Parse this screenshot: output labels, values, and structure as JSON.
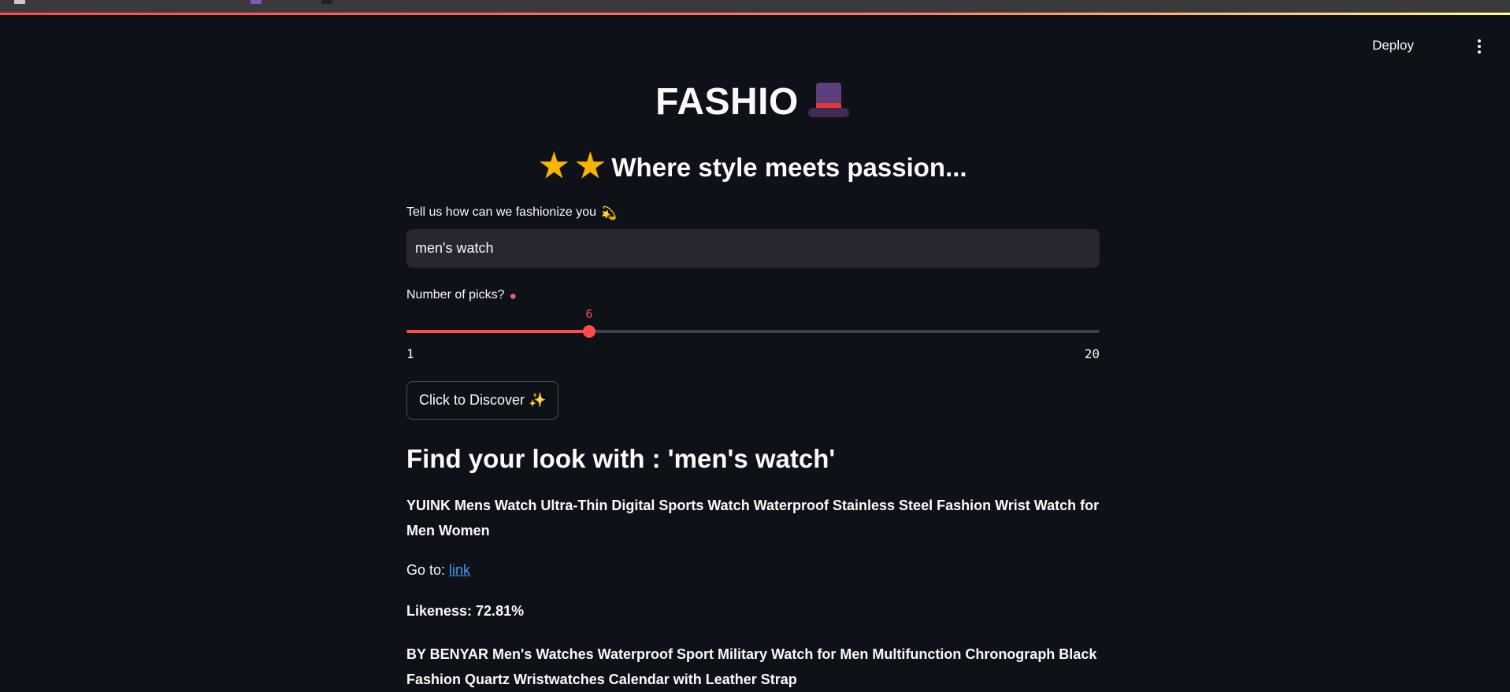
{
  "header": {
    "deploy_label": "Deploy",
    "menu_icon": "kebab-menu-icon"
  },
  "hero": {
    "title": "FASHIO",
    "title_icon": "top-hat-icon",
    "subtitle": "Where style meets passion...",
    "subtitle_icons": [
      "glowing-star-icon",
      "glowing-star-icon"
    ]
  },
  "search": {
    "label": "Tell us how can we fashionize you",
    "label_icon": "dizzy-icon",
    "value": "men's watch"
  },
  "picks": {
    "label": "Number of picks?",
    "label_icon": "lips-icon",
    "value": 6,
    "value_text": "6",
    "min": 1,
    "min_text": "1",
    "max": 20,
    "max_text": "20",
    "accent": "#ff4b4b"
  },
  "discover_button": {
    "label": "Click to Discover",
    "icon": "sparkles-icon"
  },
  "results": {
    "heading": "Find your look with : 'men's watch'",
    "goto_label": "Go to:",
    "link_text": "link",
    "items": [
      {
        "title": "YUINK Mens Watch Ultra-Thin Digital Sports Watch Waterproof Stainless Steel Fashion Wrist Watch for Men Women",
        "likeness": "Likeness: 72.81%"
      },
      {
        "title": "BY BENYAR Men's Watches Waterproof Sport Military Watch for Men Multifunction Chronograph Black Fashion Quartz Wristwatches Calendar with Leather Strap"
      }
    ]
  },
  "colors": {
    "background": "#0e1117",
    "input_bg": "#262730",
    "link": "#3d9df3"
  }
}
